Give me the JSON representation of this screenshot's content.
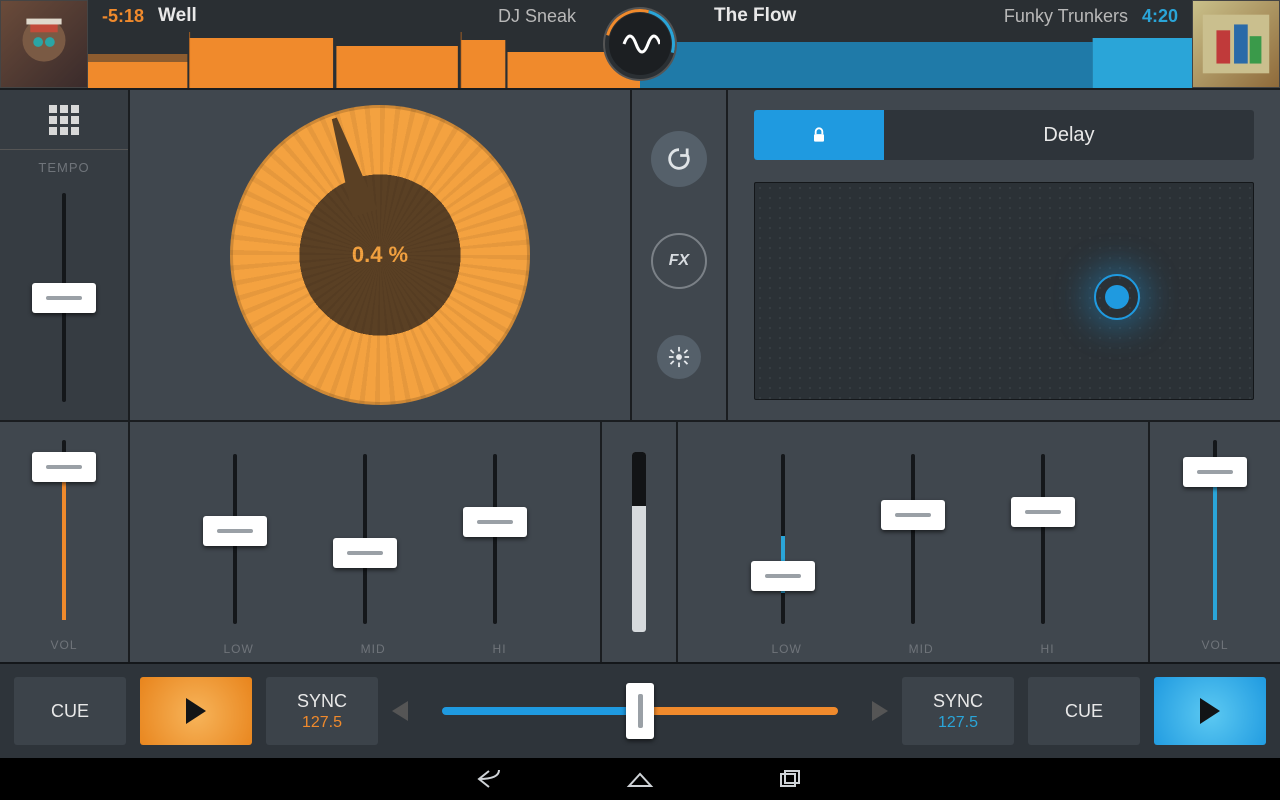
{
  "deckA": {
    "time": "-5:18",
    "title": "Well",
    "artist": "DJ Sneak",
    "color": "#f08a2c"
  },
  "deckB": {
    "time": "4:20",
    "title": "The Flow",
    "artist": "Funky Trunkers",
    "color": "#2aa5d8"
  },
  "tempo": {
    "label": "TEMPO"
  },
  "jog": {
    "pitch": "0.4 %"
  },
  "fx": {
    "lock": "locked",
    "effect": "Delay"
  },
  "eq": {
    "labels": [
      "LOW",
      "MID",
      "HI"
    ]
  },
  "vol": {
    "label": "VOL"
  },
  "centerButtons": {
    "fx": "FX"
  },
  "transport": {
    "cue": "CUE",
    "sync": "SYNC",
    "bpmA": "127.5",
    "bpmB": "127.5"
  }
}
